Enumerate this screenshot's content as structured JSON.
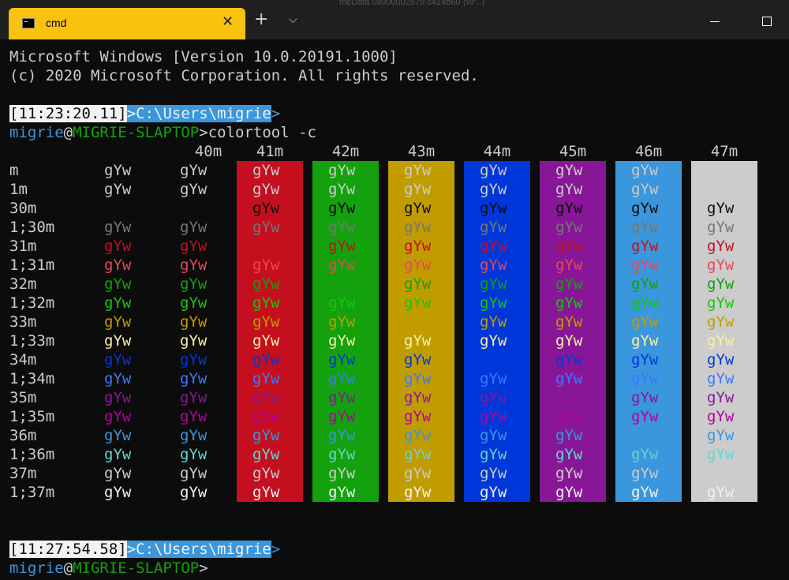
{
  "tab": {
    "title": "cmd",
    "close_glyph": "✕",
    "icon": "console-icon"
  },
  "titlebar": {
    "new_tab_glyph": "+",
    "dropdown_glyph": "⌵",
    "background_text": "meData            0x000002879 c414b60   {W\"..}",
    "minimize_icon": "minimize-icon",
    "maximize_icon": "maximize-icon"
  },
  "terminal": {
    "header_line1": "Microsoft Windows [Version 10.0.20191.1000]",
    "header_line2": "(c) 2020 Microsoft Corporation. All rights reserved.",
    "prompt1": {
      "timestamp": "[11:23:20.11]",
      "path": ">C:\\Users\\migrie",
      "arrow": ">"
    },
    "login1": {
      "user": "migrie",
      "at": "@",
      "host": "MIGRIE-SLAPTOP",
      "command": ">colortool -c"
    },
    "prompt2": {
      "timestamp": "[11:27:54.58]",
      "path": ">C:\\Users\\migrie",
      "arrow": ">"
    },
    "login2": {
      "user": "migrie",
      "at": "@",
      "host": "MIGRIE-SLAPTOP",
      "command": ">"
    }
  },
  "colortool": {
    "sample": "gYw",
    "columns": [
      "",
      "40m",
      "41m",
      "42m",
      "43m",
      "44m",
      "45m",
      "46m",
      "47m"
    ],
    "rows": [
      "m",
      "1m",
      "30m",
      "1;30m",
      "31m",
      "1;31m",
      "32m",
      "1;32m",
      "33m",
      "1;33m",
      "34m",
      "1;34m",
      "35m",
      "1;35m",
      "36m",
      "1;36m",
      "37m",
      "1;37m"
    ],
    "background_colors": [
      "#0c0c0c",
      "#0c0c0c",
      "#c50f1f",
      "#13a10e",
      "#c19c00",
      "#0037da",
      "#881798",
      "#3a96dd",
      "#cccccc"
    ],
    "foreground_colors": [
      "#cccccc",
      "#cccccc",
      "#0c0c0c",
      "#767676",
      "#c50f1f",
      "#e74856",
      "#13a10e",
      "#16c60c",
      "#c19c00",
      "#f9f1a5",
      "#0037da",
      "#3b78ff",
      "#881798",
      "#b4009e",
      "#3a96dd",
      "#61d6d6",
      "#cccccc",
      "#f2f2f2"
    ]
  }
}
